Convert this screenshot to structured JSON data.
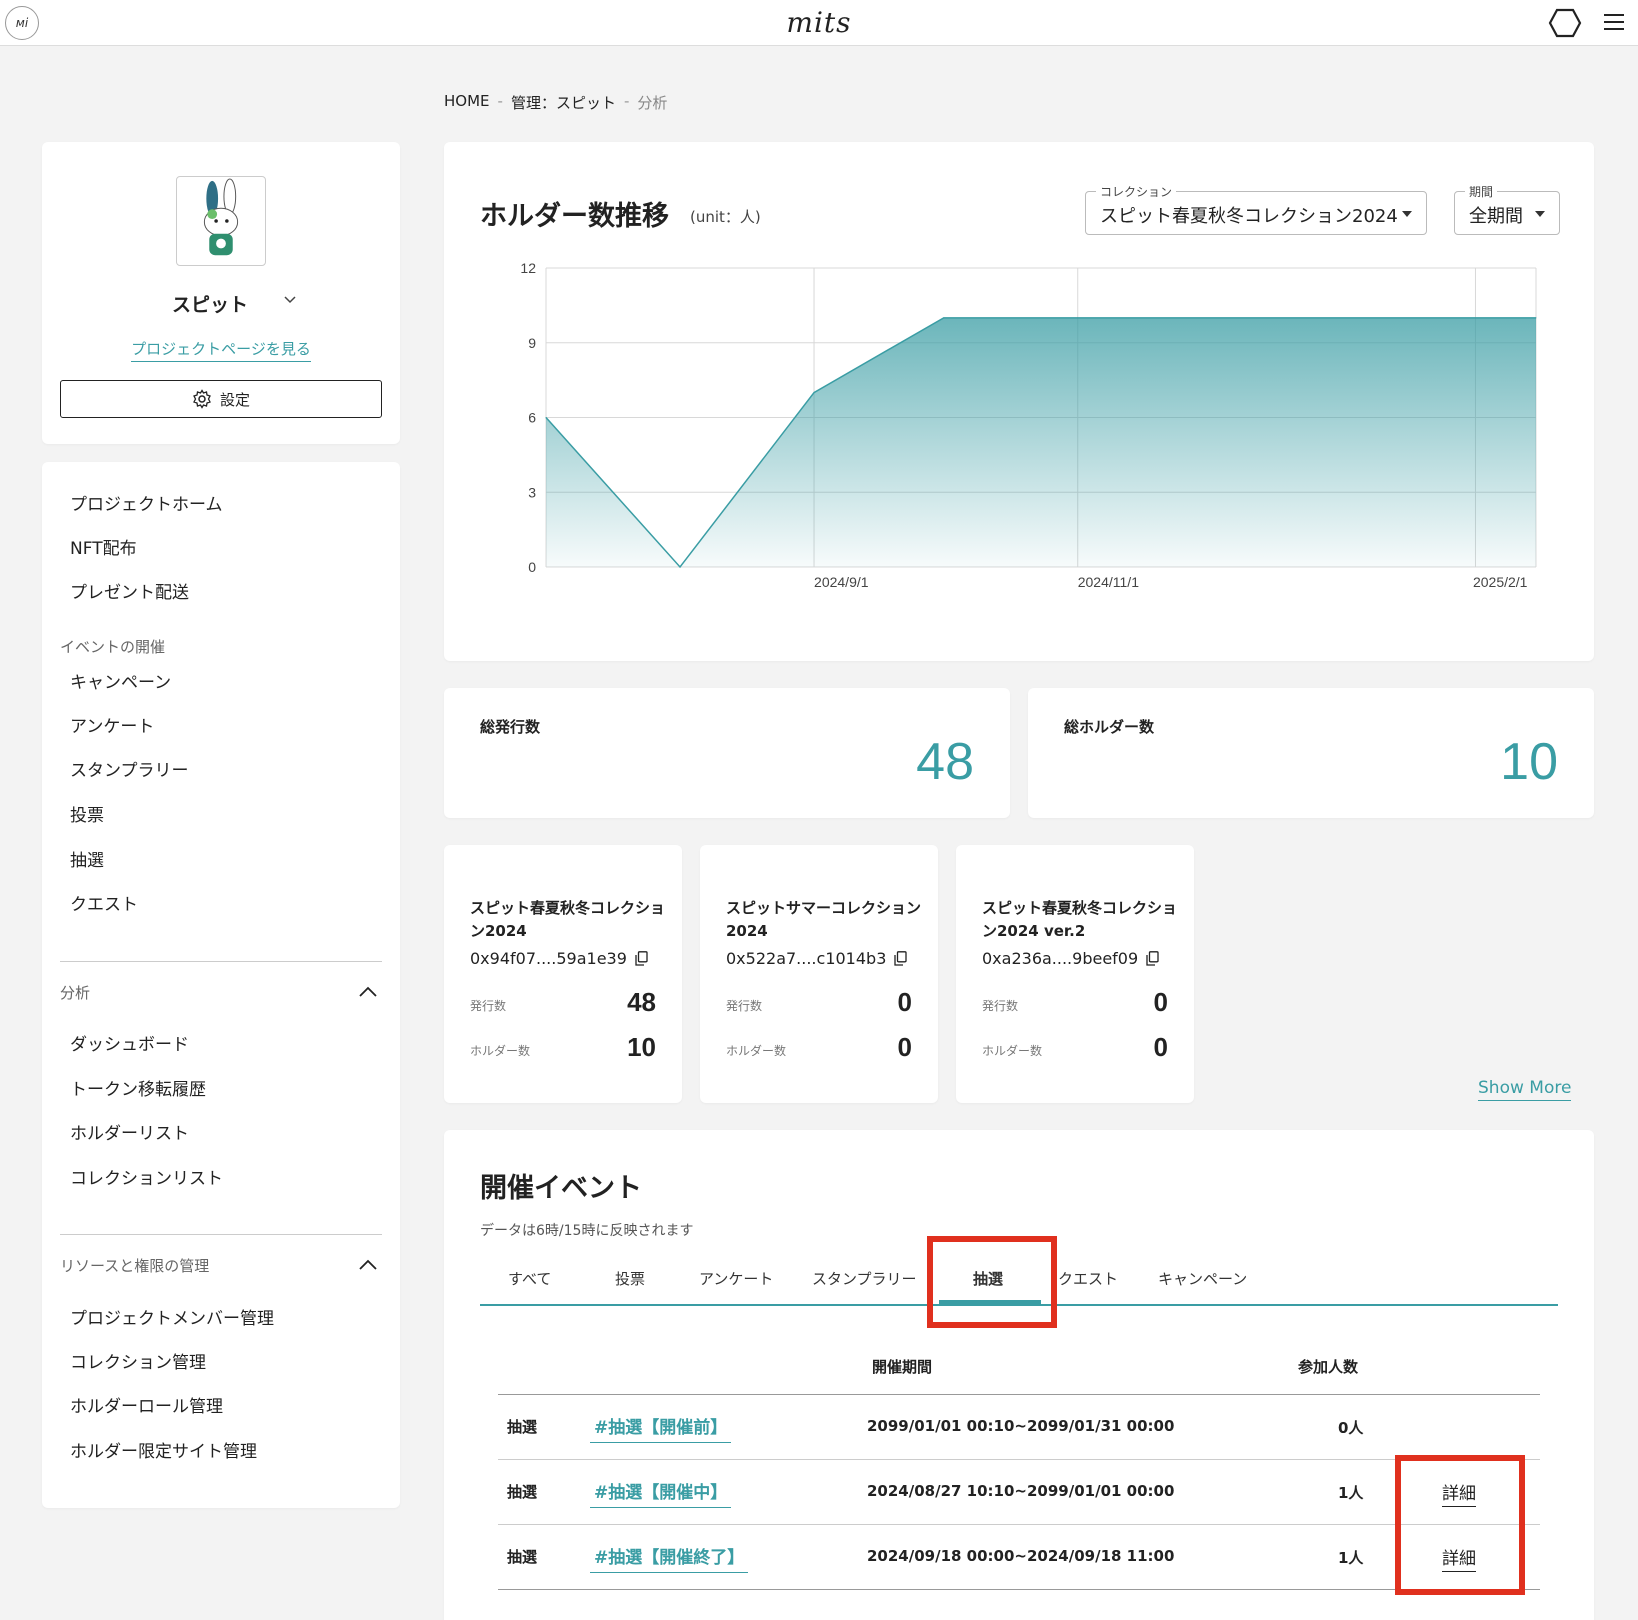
{
  "header": {
    "mini_logo": "ᴍi",
    "brand": "mits",
    "icons": [
      "hexagon-icon",
      "menu-icon"
    ]
  },
  "breadcrumb": [
    "HOME",
    "管理：スピット",
    "分析"
  ],
  "breadcrumb_sep": "-",
  "profile": {
    "name": "スピット",
    "link": "プロジェクトページを見る",
    "settings_label": "設定"
  },
  "sidebar": {
    "top_items": [
      "プロジェクトホーム",
      "NFT配布",
      "プレゼント配送"
    ],
    "events_section": "イベントの開催",
    "event_items": [
      "キャンペーン",
      "アンケート",
      "スタンプラリー",
      "投票",
      "抽選",
      "クエスト"
    ],
    "analysis_section": "分析",
    "analysis_items": [
      "ダッシュボード",
      "トークン移転履歴",
      "ホルダーリスト",
      "コレクションリスト"
    ],
    "resource_section": "リソースと権限の管理",
    "resource_items": [
      "プロジェクトメンバー管理",
      "コレクション管理",
      "ホルダーロール管理",
      "ホルダー限定サイト管理"
    ]
  },
  "chart_card": {
    "title": "ホルダー数推移",
    "unit": "(unit：人)",
    "collection_label": "コレクション",
    "collection_value": "スピット春夏秋冬コレクション2024",
    "period_label": "期間",
    "period_value": "全期間"
  },
  "chart_data": {
    "type": "area",
    "title": "ホルダー数推移",
    "ylim": [
      0,
      12
    ],
    "yticks": [
      0,
      3,
      6,
      9,
      12
    ],
    "x_tick_labels": [
      "2024/9/1",
      "2024/11/1",
      "2025/2/1"
    ],
    "x": [
      "2024/7/1",
      "2024/8/1",
      "2024/9/1",
      "2024/10/1",
      "2024/11/1",
      "2025/2/15"
    ],
    "values": [
      6,
      0,
      7,
      10,
      10,
      10
    ],
    "grid": true,
    "color": "#3a9da4"
  },
  "stats": [
    {
      "label": "総発行数",
      "value": "48"
    },
    {
      "label": "総ホルダー数",
      "value": "10"
    }
  ],
  "collections": [
    {
      "name": "スピット春夏秋冬コレクション2024",
      "address": "0x94f07....59a1e39",
      "issued_label": "発行数",
      "issued": "48",
      "holders_label": "ホルダー数",
      "holders": "10"
    },
    {
      "name": "スピットサマーコレクション2024",
      "address": "0x522a7....c1014b3",
      "issued_label": "発行数",
      "issued": "0",
      "holders_label": "ホルダー数",
      "holders": "0"
    },
    {
      "name": "スピット春夏秋冬コレクション2024 ver.2",
      "address": "0xa236a....9beef09",
      "issued_label": "発行数",
      "issued": "0",
      "holders_label": "ホルダー数",
      "holders": "0"
    }
  ],
  "show_more": "Show More",
  "events": {
    "title": "開催イベント",
    "note": "データは6時/15時に反映されます",
    "tabs": [
      "すべて",
      "投票",
      "アンケート",
      "スタンプラリー",
      "抽選",
      "クエスト",
      "キャンペーン"
    ],
    "active_tab": "抽選",
    "col_period": "開催期間",
    "col_participants": "参加人数",
    "rows": [
      {
        "type": "抽選",
        "name": "#抽選【開催前】",
        "period": "2099/01/01 00:10~2099/01/31 00:00",
        "participants": "0人",
        "detail": ""
      },
      {
        "type": "抽選",
        "name": "#抽選【開催中】",
        "period": "2024/08/27 10:10~2099/01/01 00:00",
        "participants": "1人",
        "detail": "詳細"
      },
      {
        "type": "抽選",
        "name": "#抽選【開催終了】",
        "period": "2024/09/18 00:00~2024/09/18 11:00",
        "participants": "1人",
        "detail": "詳細"
      }
    ]
  }
}
